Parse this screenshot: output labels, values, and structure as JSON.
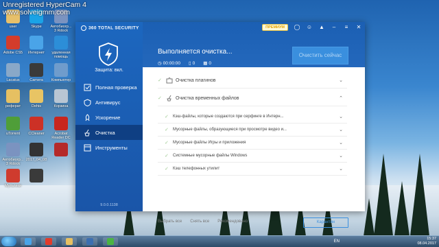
{
  "watermark": {
    "line1": "Unregistered HyperCam 4",
    "line2": "www.solveigmm.com"
  },
  "desktop_icons": [
    {
      "label": "user",
      "color": "#e7c06a"
    },
    {
      "label": "Skype",
      "color": "#1aa3e6"
    },
    {
      "label": "Автобиогр... 3 Rdock",
      "color": "#7b93c0"
    },
    {
      "label": "Adobe CS5",
      "color": "#d33c2c"
    },
    {
      "label": "Интернет",
      "color": "#4aa4e8"
    },
    {
      "label": "удаленная помощь",
      "color": "#2c8ed8"
    },
    {
      "label": "Lacatus",
      "color": "#89a8c8"
    },
    {
      "label": "Camera",
      "color": "#3a3a3a"
    },
    {
      "label": "Компьютер",
      "color": "#6f9ccc"
    },
    {
      "label": "реферат",
      "color": "#e6c062"
    },
    {
      "label": "Dehis",
      "color": "#e8c464"
    },
    {
      "label": "Корзина",
      "color": "#b9c6d3"
    },
    {
      "label": "uTorrent",
      "color": "#4f9e39"
    },
    {
      "label": "CCleaner",
      "color": "#cc3126"
    },
    {
      "label": "Acrobat Reader DC",
      "color": "#c8261e"
    },
    {
      "label": "Автобиогр... 3 Rdock",
      "color": "#7b93c0"
    },
    {
      "label": "2017_04_08",
      "color": "#333333"
    },
    {
      "label": "",
      "color": "#b52a2a"
    },
    {
      "label": "Мультики",
      "color": "#cf3b2e"
    },
    {
      "label": "",
      "color": "#3a3a3a"
    }
  ],
  "app": {
    "brand": "360 TOTAL SECURITY",
    "protection_status": "Защита: вкл.",
    "nav": [
      {
        "label": "Полная проверка",
        "icon": "full-scan-icon"
      },
      {
        "label": "Антивирус",
        "icon": "antivirus-icon"
      },
      {
        "label": "Ускорение",
        "icon": "speedup-icon"
      },
      {
        "label": "Очистка",
        "icon": "cleanup-icon"
      },
      {
        "label": "Инструменты",
        "icon": "tools-icon"
      }
    ],
    "active_nav": "Очистка",
    "version": "9.0.0.1138",
    "premium_label": "ПРЕМИУМ",
    "status_title": "Выполняется очистка...",
    "timer": "00:00:00",
    "count_a": "0",
    "count_b": "0",
    "clean_now": "Очистить сейчас",
    "sections": [
      {
        "label": "Очистка плагинов",
        "expanded": false
      },
      {
        "label": "Очистка временных файлов",
        "expanded": true
      }
    ],
    "sub_items": [
      "Кэш-файлы, которые создаются при серфинге в Интерн...",
      "Мусорные файлы, образующиеся при просмотре видео и...",
      "Мусорные файлы Игры и приложения",
      "Системные мусорные файлы Windows",
      "Кэш телефонных утилит"
    ],
    "select_all": "Выбрать все",
    "deselect_all": "Снять все",
    "recommended": "Рекомендовано",
    "quarantine": "Карантин"
  },
  "taskbar": {
    "lang": "EN",
    "time": "15:37",
    "date": "08.04.2017",
    "apps": [
      {
        "name": "chrome",
        "color": "#4aa4e8"
      },
      {
        "name": "yandex",
        "color": "#e23b2b"
      },
      {
        "name": "explorer",
        "color": "#e6c062"
      },
      {
        "name": "media",
        "color": "#3d6fb0"
      },
      {
        "name": "360",
        "color": "#4bb443"
      }
    ]
  }
}
